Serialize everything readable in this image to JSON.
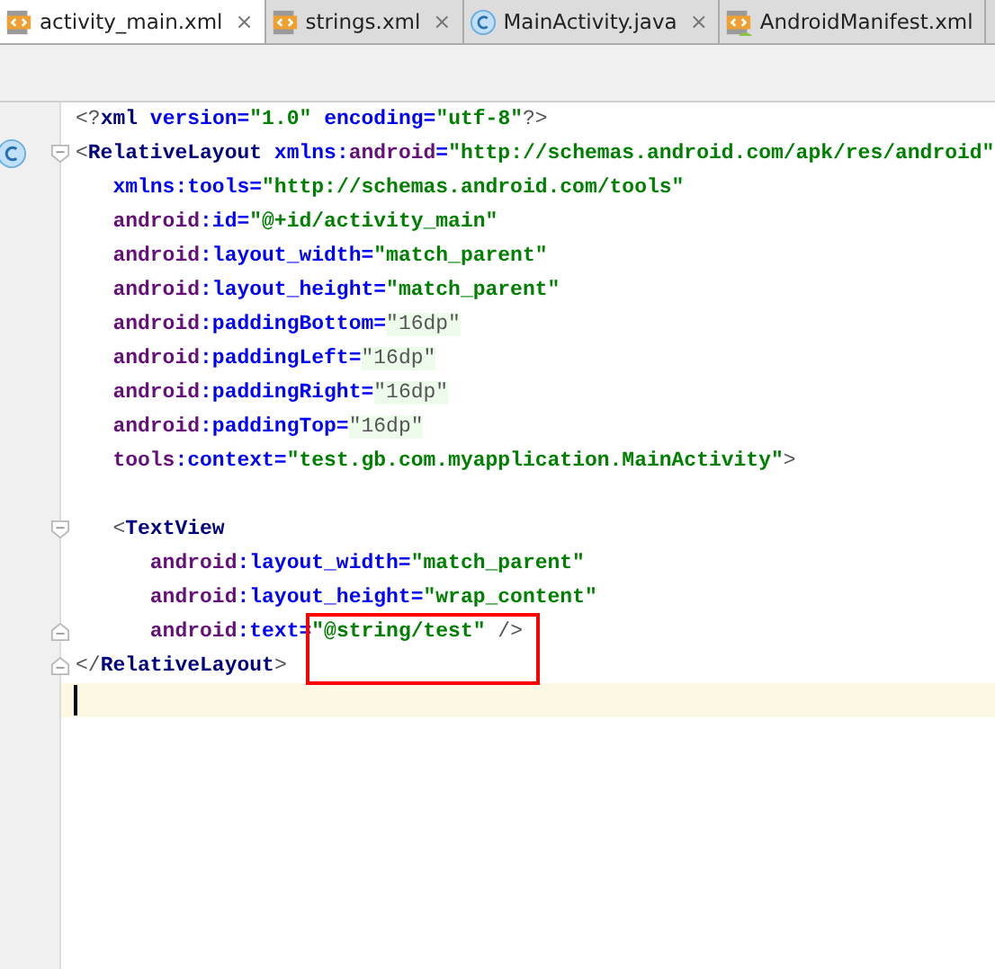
{
  "tabs": [
    {
      "label": "activity_main.xml",
      "selected": true,
      "close": "×"
    },
    {
      "label": "strings.xml",
      "selected": false,
      "close": "×"
    },
    {
      "label": "MainActivity.java",
      "selected": false,
      "close": "×"
    },
    {
      "label": "AndroidManifest.xml",
      "selected": false
    }
  ],
  "editor": {
    "lines": [
      {
        "current": false,
        "tokens": [
          {
            "kind": "punct",
            "text": "<?"
          },
          {
            "kind": "tag",
            "text": "xml"
          },
          {
            "kind": "attr",
            "text": " version="
          },
          {
            "kind": "value",
            "text": "\"1.0\""
          },
          {
            "kind": "attr",
            "text": " encoding="
          },
          {
            "kind": "value",
            "text": "\"utf-8\""
          },
          {
            "kind": "punct",
            "text": "?>"
          }
        ]
      },
      {
        "current": false,
        "tokens": [
          {
            "kind": "punct",
            "text": "<"
          },
          {
            "kind": "tag",
            "text": "RelativeLayout"
          },
          {
            "kind": "attr",
            "text": " xmlns:"
          },
          {
            "kind": "ns",
            "text": "android"
          },
          {
            "kind": "attr",
            "text": "="
          },
          {
            "kind": "value",
            "text": "\"http://schemas.android.com/apk/res/android\""
          }
        ]
      },
      {
        "current": false,
        "tokens": [
          {
            "kind": "attr",
            "text": "   xmlns:tools="
          },
          {
            "kind": "value",
            "text": "\"http://schemas.android.com/tools\""
          }
        ]
      },
      {
        "current": false,
        "tokens": [
          {
            "kind": "ns",
            "text": "   android"
          },
          {
            "kind": "attr",
            "text": ":id="
          },
          {
            "kind": "value",
            "text": "\"@+id/activity_main\""
          }
        ]
      },
      {
        "current": false,
        "tokens": [
          {
            "kind": "ns",
            "text": "   android"
          },
          {
            "kind": "attr",
            "text": ":layout_width="
          },
          {
            "kind": "value",
            "text": "\"match_parent\""
          }
        ]
      },
      {
        "current": false,
        "tokens": [
          {
            "kind": "ns",
            "text": "   android"
          },
          {
            "kind": "attr",
            "text": ":layout_height="
          },
          {
            "kind": "value",
            "text": "\"match_parent\""
          }
        ]
      },
      {
        "current": false,
        "tokens": [
          {
            "kind": "ns",
            "text": "   android"
          },
          {
            "kind": "attr",
            "text": ":paddingBottom="
          },
          {
            "kind": "dim",
            "text": "\"16dp\""
          }
        ]
      },
      {
        "current": false,
        "tokens": [
          {
            "kind": "ns",
            "text": "   android"
          },
          {
            "kind": "attr",
            "text": ":paddingLeft="
          },
          {
            "kind": "dim",
            "text": "\"16dp\""
          }
        ]
      },
      {
        "current": false,
        "tokens": [
          {
            "kind": "ns",
            "text": "   android"
          },
          {
            "kind": "attr",
            "text": ":paddingRight="
          },
          {
            "kind": "dim",
            "text": "\"16dp\""
          }
        ]
      },
      {
        "current": false,
        "tokens": [
          {
            "kind": "ns",
            "text": "   android"
          },
          {
            "kind": "attr",
            "text": ":paddingTop="
          },
          {
            "kind": "dim",
            "text": "\"16dp\""
          }
        ]
      },
      {
        "current": false,
        "tokens": [
          {
            "kind": "ns",
            "text": "   tools"
          },
          {
            "kind": "attr",
            "text": ":context="
          },
          {
            "kind": "value",
            "text": "\"test.gb.com.myapplication.MainActivity\""
          },
          {
            "kind": "punct",
            "text": ">"
          }
        ]
      },
      {
        "current": false
      },
      {
        "current": false,
        "tokens": [
          {
            "kind": "punct",
            "text": "   <"
          },
          {
            "kind": "tag",
            "text": "TextView"
          }
        ]
      },
      {
        "current": false,
        "tokens": [
          {
            "kind": "ns",
            "text": "      android"
          },
          {
            "kind": "attr",
            "text": ":layout_width="
          },
          {
            "kind": "value",
            "text": "\"match_parent\""
          }
        ]
      },
      {
        "current": false,
        "tokens": [
          {
            "kind": "ns",
            "text": "      android"
          },
          {
            "kind": "attr",
            "text": ":layout_height="
          },
          {
            "kind": "value",
            "text": "\"wrap_content\""
          }
        ]
      },
      {
        "current": false,
        "tokens": [
          {
            "kind": "ns",
            "text": "      android"
          },
          {
            "kind": "attr",
            "text": ":text="
          },
          {
            "kind": "value",
            "text": "\"@string/test\""
          },
          {
            "kind": "punct",
            "text": " />"
          }
        ]
      },
      {
        "current": false,
        "tokens": [
          {
            "kind": "punct",
            "text": "</"
          },
          {
            "kind": "tag",
            "text": "RelativeLayout"
          },
          {
            "kind": "punct",
            "text": ">"
          }
        ]
      },
      {
        "current": true
      }
    ]
  }
}
